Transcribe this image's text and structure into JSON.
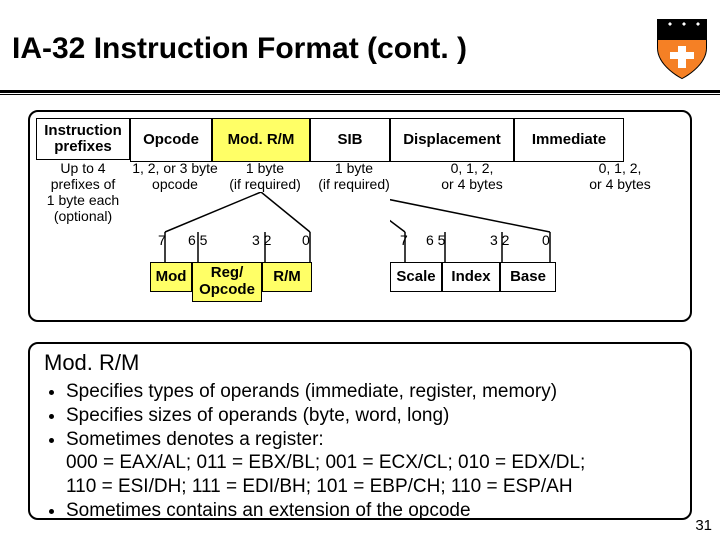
{
  "title": "IA-32 Instruction Format (cont. )",
  "headers": {
    "prefixes_l1": "Instruction",
    "prefixes_l2": "prefixes",
    "opcode": "Opcode",
    "modrm": "Mod. R/M",
    "sib": "SIB",
    "disp": "Displacement",
    "imm": "Immediate"
  },
  "subs": {
    "prefixes": "Up to 4\nprefixes of\n1 byte each\n(optional)",
    "opcode": "1, 2, or 3 byte\nopcode",
    "modrm": "1 byte\n(if required)",
    "sib": "1 byte\n(if required)",
    "disp": "0, 1, 2,\nor 4 bytes",
    "imm": "0, 1, 2,\nor 4 bytes"
  },
  "modrm_bits": {
    "b7": "7",
    "b65": "6 5",
    "b32": "3 2",
    "b0": "0"
  },
  "modrm_fields": {
    "mod": "Mod",
    "reg_l1": "Reg/",
    "reg_l2": "Opcode",
    "rm": "R/M"
  },
  "sib_bits": {
    "b7": "7",
    "b65": "6 5",
    "b32": "3 2",
    "b0": "0"
  },
  "sib_fields": {
    "scale": "Scale",
    "index": "Index",
    "base": "Base"
  },
  "desc": {
    "heading": "Mod. R/M",
    "b1": "Specifies types of operands (immediate, register, memory)",
    "b2": "Specifies sizes of operands (byte, word, long)",
    "b3a": "Sometimes denotes a register:",
    "b3b": "000 = EAX/AL; 011 = EBX/BL; 001 = ECX/CL; 010 = EDX/DL;",
    "b3c": "110 = ESI/DH; 111 = EDI/BH; 101 = EBP/CH; 110 = ESP/AH",
    "b4": "Sometimes contains an extension of the opcode"
  },
  "pagenum": "31"
}
